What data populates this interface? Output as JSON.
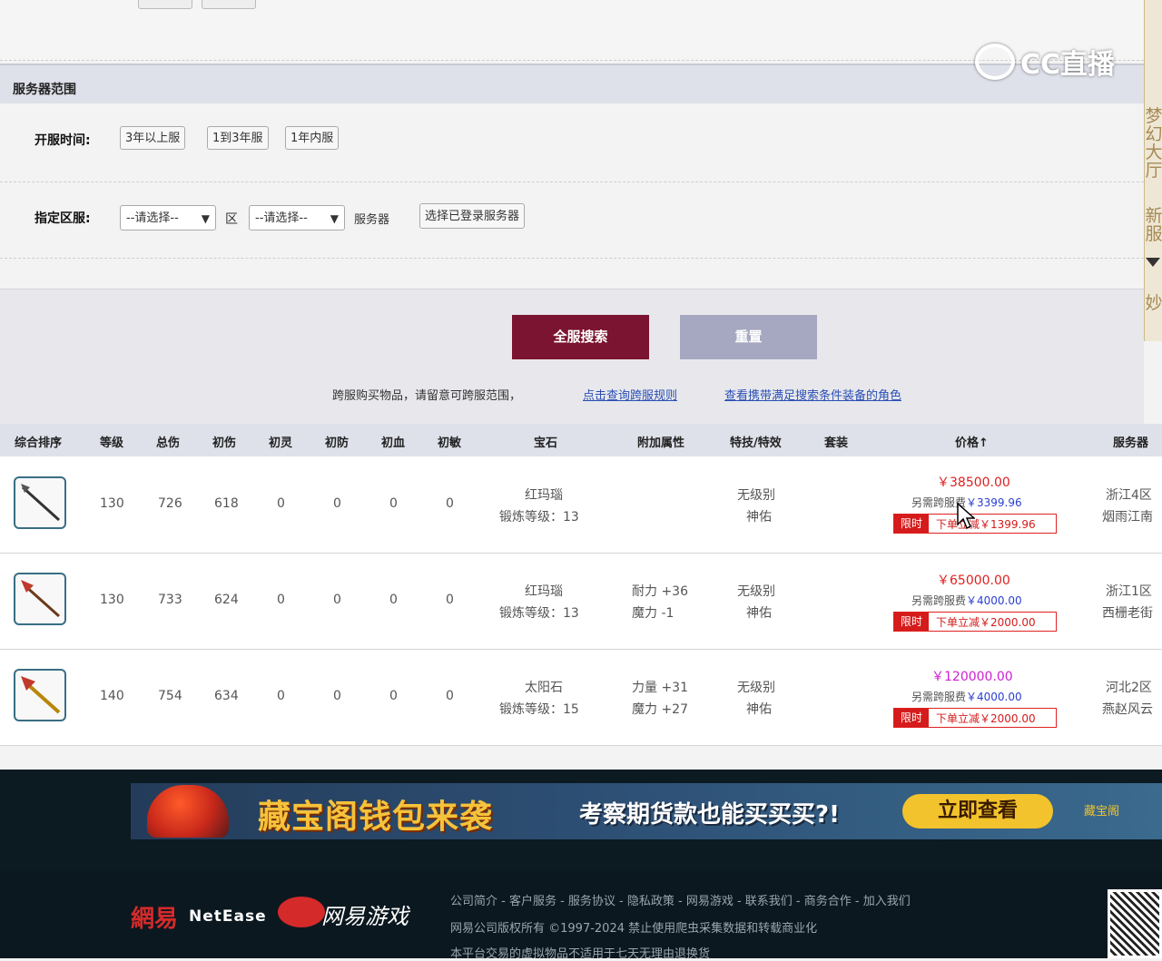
{
  "server_section": {
    "title": "服务器范围",
    "open_time_label": "开服时间:",
    "open_time_options": [
      "3年以上服",
      "1到3年服",
      "1年内服"
    ],
    "region_label": "指定区服:",
    "area_select": "--请选择--",
    "area_unit": "区",
    "server_select": "--请选择--",
    "server_unit": "服务器",
    "logged_server_button": "选择已登录服务器"
  },
  "actions": {
    "search_label": "全服搜索",
    "reset_label": "重置",
    "notice_text": "跨服购买物品，请留意可跨服范围，",
    "notice_link1": "点击查询跨服规则",
    "notice_link2": "查看携带满足搜索条件装备的角色"
  },
  "table": {
    "headers": {
      "sort": "综合排序",
      "level": "等级",
      "total_dmg": "总伤",
      "init_dmg": "初伤",
      "init_spirit": "初灵",
      "init_def": "初防",
      "init_hp": "初血",
      "init_agi": "初敏",
      "gem": "宝石",
      "attr": "附加属性",
      "skill": "特技/特效",
      "set": "套装",
      "price": "价格↑",
      "server": "服务器"
    },
    "rows": [
      {
        "level": "130",
        "total_dmg": "726",
        "init_dmg": "618",
        "init_spirit": "0",
        "init_def": "0",
        "init_hp": "0",
        "init_agi": "0",
        "gem_name": "红玛瑙",
        "gem_level": "锻炼等级：13",
        "attr1": "",
        "attr2": "",
        "skill1": "无级别",
        "skill2": "神佑",
        "price": "￥38500.00",
        "price_color": "#e02020",
        "fee_label": "另需跨服费",
        "fee": "￥3399.96",
        "promo_tag": "限时",
        "promo_text": "下单立减￥1399.96",
        "server1": "浙江4区",
        "server2": "烟雨江南",
        "icon": "spear-icon"
      },
      {
        "level": "130",
        "total_dmg": "733",
        "init_dmg": "624",
        "init_spirit": "0",
        "init_def": "0",
        "init_hp": "0",
        "init_agi": "0",
        "gem_name": "红玛瑙",
        "gem_level": "锻炼等级：13",
        "attr1": "耐力 +36",
        "attr2": "魔力 -1",
        "skill1": "无级别",
        "skill2": "神佑",
        "price": "￥65000.00",
        "price_color": "#e02020",
        "fee_label": "另需跨服费",
        "fee": "￥4000.00",
        "promo_tag": "限时",
        "promo_text": "下单立减￥2000.00",
        "server1": "浙江1区",
        "server2": "西栅老街",
        "icon": "spear-icon"
      },
      {
        "level": "140",
        "total_dmg": "754",
        "init_dmg": "634",
        "init_spirit": "0",
        "init_def": "0",
        "init_hp": "0",
        "init_agi": "0",
        "gem_name": "太阳石",
        "gem_level": "锻炼等级：15",
        "attr1": "力量 +31",
        "attr2": "魔力 +27",
        "skill1": "无级别",
        "skill2": "神佑",
        "price": "￥120000.00",
        "price_color": "#d020d0",
        "fee_label": "另需跨服费",
        "fee": "￥4000.00",
        "promo_tag": "限时",
        "promo_text": "下单立减￥2000.00",
        "server1": "河北2区",
        "server2": "燕赵风云",
        "icon": "spear-icon"
      }
    ]
  },
  "banner": {
    "title": "藏宝阁钱包来袭",
    "subtitle": "考察期货款也能买买买?!",
    "cta": "立即查看",
    "logo": "藏宝阁"
  },
  "footer": {
    "netease_cn": "網易",
    "netease_en": "NetEase",
    "games": "网易游戏",
    "links": "公司简介 - 客户服务 - 服务协议 - 隐私政策 - 网易游戏 - 联系我们 - 商务合作 - 加入我们",
    "copyright": "网易公司版权所有 ©1997-2024  禁止使用爬虫采集数据和转载商业化",
    "note": "本平台交易的虚拟物品不适用于七天无理由退换货"
  },
  "side_panel": {
    "items": [
      "梦幻大厅",
      "新服",
      "妙"
    ]
  },
  "watermark": "CC直播"
}
